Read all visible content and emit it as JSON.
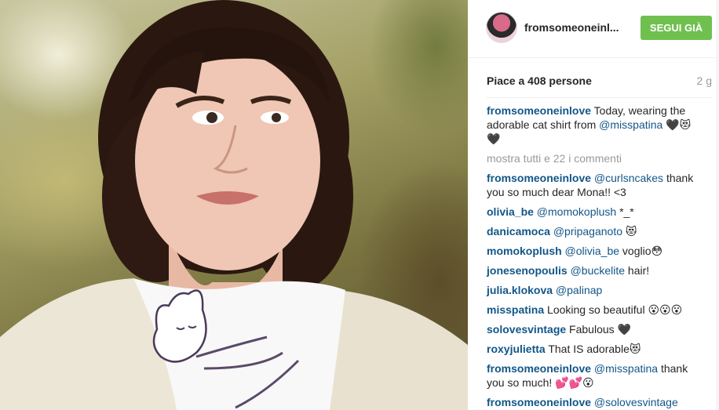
{
  "post": {
    "username": "fromsomeoneinl...",
    "follow_label": "SEGUI GIÀ",
    "likes": "Piace a 408 persone",
    "age": "2 g",
    "caption": {
      "user": "fromsomeoneinlove",
      "text_before": " Today, wearing the adorable cat shirt from ",
      "mention": "@misspatina",
      "text_after": " 🖤😻🖤"
    },
    "show_all": "mostra tutti e 22 i commenti",
    "comments": [
      {
        "user": "fromsomeoneinlove",
        "mention": " @curlsncakes",
        "text": " thank you so much dear Mona!! <3"
      },
      {
        "user": "olivia_be",
        "mention": " @momokoplush",
        "text": " *_*"
      },
      {
        "user": "danicamoca",
        "mention": " @pripaganoto",
        "text": " 😻"
      },
      {
        "user": "momokoplush",
        "mention": " @olivia_be",
        "text": " voglio😳"
      },
      {
        "user": "jonesenopoulis",
        "mention": " @buckelite",
        "text": " hair!"
      },
      {
        "user": "julia.klokova",
        "mention": " @palinap",
        "text": ""
      },
      {
        "user": "misspatina",
        "mention": "",
        "text": " Looking so beautiful 😮😮😮"
      },
      {
        "user": "solovesvintage",
        "mention": "",
        "text": " Fabulous 🖤"
      },
      {
        "user": "roxyjulietta",
        "mention": "",
        "text": " That IS adorable😻"
      },
      {
        "user": "fromsomeoneinlove",
        "mention": " @misspatina",
        "text": " thank you so much! 💕💕😮"
      },
      {
        "user": "fromsomeoneinlove",
        "mention": " @solovesvintage",
        "text": ""
      }
    ]
  },
  "colors": {
    "follow_button": "#70c050",
    "username": "#125688",
    "muted": "#999999"
  }
}
